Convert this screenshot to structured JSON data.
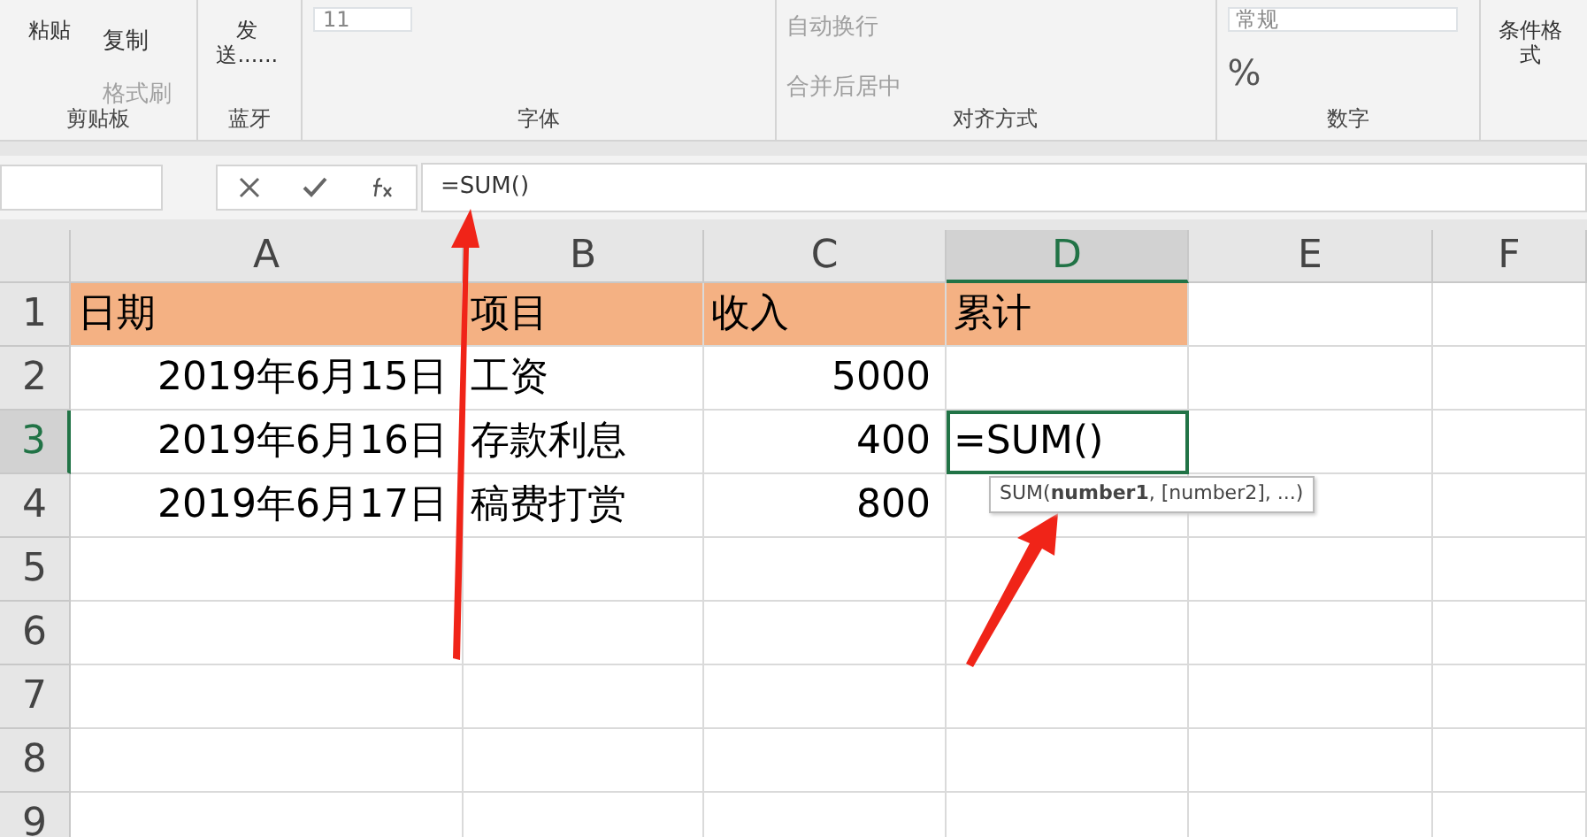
{
  "ribbon": {
    "groups": [
      {
        "label": "剪贴板",
        "items": [
          {
            "kind": "big",
            "text": "粘贴"
          },
          {
            "kind": "small",
            "text": "复制",
            "disabled": false
          },
          {
            "kind": "small",
            "text": "格式刷",
            "disabled": true
          }
        ]
      },
      {
        "label": "蓝牙",
        "items": [
          {
            "kind": "big",
            "text": "发送......"
          }
        ]
      },
      {
        "label": "字体",
        "items": [
          {
            "kind": "size",
            "text": "11"
          }
        ]
      },
      {
        "label": "对齐方式",
        "items": [
          {
            "kind": "small",
            "text": "自动换行",
            "disabled": true
          },
          {
            "kind": "small",
            "text": "合并后居中",
            "disabled": true
          }
        ]
      },
      {
        "label": "数字",
        "items": [
          {
            "kind": "format",
            "text": "常规"
          },
          {
            "kind": "symbol",
            "text": "%"
          }
        ]
      },
      {
        "items": [
          {
            "kind": "big",
            "text": "条件格式"
          }
        ]
      }
    ]
  },
  "formula_bar": {
    "formula": "=SUM()"
  },
  "sheet": {
    "columns": [
      {
        "label": "A",
        "selected": false
      },
      {
        "label": "B",
        "selected": false
      },
      {
        "label": "C",
        "selected": false
      },
      {
        "label": "D",
        "selected": true
      },
      {
        "label": "E",
        "selected": false
      },
      {
        "label": "F",
        "selected": false
      }
    ],
    "rows": [
      {
        "label": "1",
        "selected": false,
        "highlight": true,
        "cells": [
          {
            "text": "日期",
            "kind": "text"
          },
          {
            "text": "项目",
            "kind": "text"
          },
          {
            "text": "收入",
            "kind": "text"
          },
          {
            "text": "累计",
            "kind": "text"
          }
        ]
      },
      {
        "label": "2",
        "selected": false,
        "highlight": false,
        "cells": [
          {
            "text": "2019年6月15日",
            "kind": "number"
          },
          {
            "text": "工资",
            "kind": "text"
          },
          {
            "text": "5000",
            "kind": "number"
          },
          {
            "text": "",
            "kind": "text"
          }
        ]
      },
      {
        "label": "3",
        "selected": true,
        "highlight": false,
        "cells": [
          {
            "text": "2019年6月16日",
            "kind": "number"
          },
          {
            "text": "存款利息",
            "kind": "text"
          },
          {
            "text": "400",
            "kind": "number"
          },
          {
            "text": "=SUM()",
            "kind": "editing"
          }
        ]
      },
      {
        "label": "4",
        "selected": false,
        "highlight": false,
        "cells": [
          {
            "text": "2019年6月17日",
            "kind": "number"
          },
          {
            "text": "稿费打赏",
            "kind": "text"
          },
          {
            "text": "800",
            "kind": "number"
          }
        ]
      },
      {
        "label": "5",
        "selected": false,
        "highlight": false,
        "cells": []
      },
      {
        "label": "6",
        "selected": false,
        "highlight": false,
        "cells": []
      },
      {
        "label": "7",
        "selected": false,
        "highlight": false,
        "cells": []
      },
      {
        "label": "8",
        "selected": false,
        "highlight": false,
        "cells": []
      },
      {
        "label": "9",
        "selected": false,
        "highlight": false,
        "cells": []
      }
    ],
    "tooltip": "SUM(**number1**, [number2], ...)"
  }
}
